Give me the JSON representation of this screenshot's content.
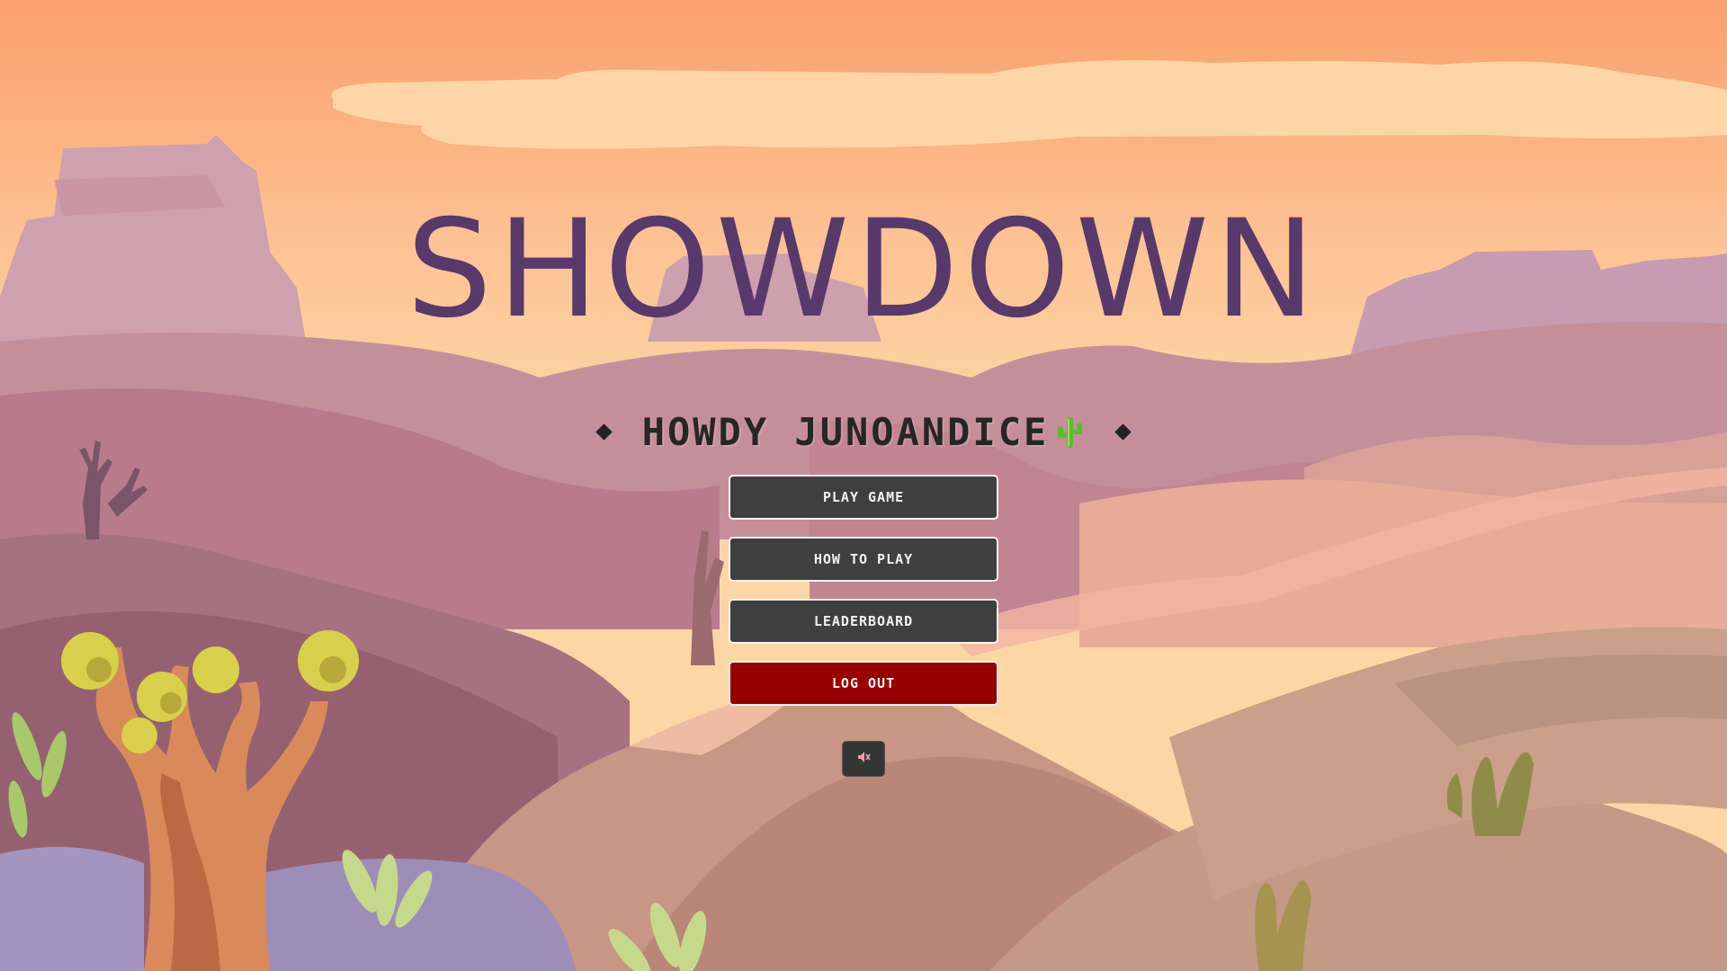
{
  "game": {
    "title": "SHOWDOWN",
    "greeting": "HOWDY JUNOANDICE"
  },
  "menu": {
    "play_label": "PLAY GAME",
    "how_to_play_label": "HOW TO PLAY",
    "leaderboard_label": "LEADERBOARD",
    "logout_label": "LOG OUT"
  },
  "controls": {
    "sound_icon": "speaker-muted-icon"
  },
  "icons": {
    "greeting_icon": "cactus-icon",
    "decorations": [
      "diamond-icon",
      "diamond-icon"
    ]
  },
  "colors": {
    "title": "#573a6b",
    "button": "#3f3f3f",
    "logout_button": "#980000",
    "sky_top": "#f9a472",
    "sky_bottom": "#fdd3a2"
  }
}
